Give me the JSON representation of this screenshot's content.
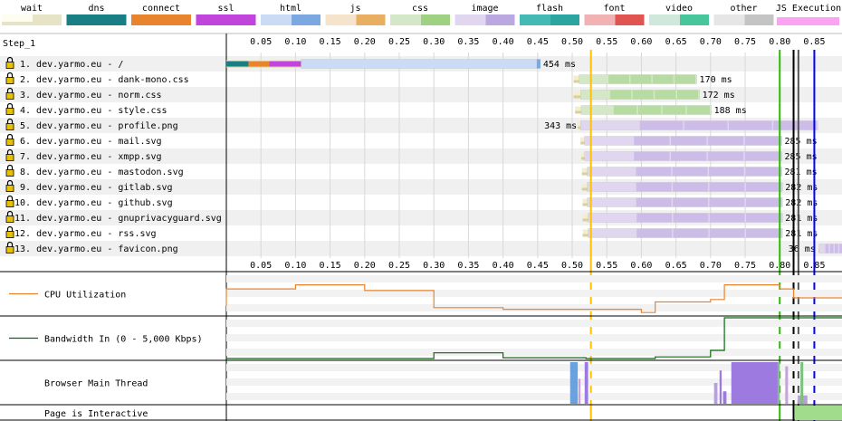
{
  "legend": [
    {
      "name": "wait",
      "color": "#fefdf2",
      "dark": "#e7e3c6"
    },
    {
      "name": "dns",
      "color": "#1a7f85",
      "dark": "#1a7f85"
    },
    {
      "name": "connect",
      "color": "#e7842d",
      "dark": "#e7842d"
    },
    {
      "name": "ssl",
      "color": "#c144dd",
      "dark": "#c144dd"
    },
    {
      "name": "html",
      "color": "#c9dcf4",
      "dark": "#7ba8e0"
    },
    {
      "name": "js",
      "color": "#f6e3cc",
      "dark": "#e8ae62"
    },
    {
      "name": "css",
      "color": "#d4e8c8",
      "dark": "#9ed182"
    },
    {
      "name": "image",
      "color": "#e0d6f0",
      "dark": "#bca8e0"
    },
    {
      "name": "flash",
      "color": "#45b9b4",
      "dark": "#2aa5a0"
    },
    {
      "name": "font",
      "color": "#f0b2b2",
      "dark": "#e0554f"
    },
    {
      "name": "video",
      "color": "#cfe8dc",
      "dark": "#47c59b"
    },
    {
      "name": "other",
      "color": "#e6e6e6",
      "dark": "#c4c4c4"
    },
    {
      "name": "JS Execution",
      "color": "#fba2f0",
      "dark": "#fba2f0"
    }
  ],
  "step_label": "Step_1",
  "chart_data": {
    "type": "waterfall",
    "x_unit": "seconds",
    "xlim": [
      0,
      0.89
    ],
    "ticks": [
      "0.05",
      "0.10",
      "0.15",
      "0.20",
      "0.25",
      "0.30",
      "0.35",
      "0.40",
      "0.45",
      "0.50",
      "0.55",
      "0.60",
      "0.65",
      "0.70",
      "0.75",
      "0.80",
      "0.85"
    ],
    "markers": [
      {
        "t": 0.527,
        "color": "#ffc000"
      },
      {
        "t": 0.8,
        "color": "#28bc00"
      },
      {
        "t": 0.82,
        "color": "#000000"
      },
      {
        "t": 0.827,
        "color": "#555555"
      },
      {
        "t": 0.85,
        "color": "#0000ff"
      }
    ],
    "requests": [
      {
        "label": "1. dev.yarmo.eu - /",
        "type": "html",
        "wait_start": 0.0,
        "dns": [
          0.0,
          0.032
        ],
        "connect": [
          0.032,
          0.062
        ],
        "ssl": [
          0.062,
          0.108
        ],
        "start": 0.108,
        "end": 0.454,
        "time": "454 ms",
        "time_left": false
      },
      {
        "label": "2. dev.yarmo.eu - dank-mono.css",
        "type": "css",
        "wait_start": 0.502,
        "start": 0.51,
        "end": 0.68,
        "time": "170 ms",
        "time_left": false
      },
      {
        "label": "3. dev.yarmo.eu - norm.css",
        "type": "css",
        "wait_start": 0.502,
        "start": 0.512,
        "end": 0.684,
        "time": "172 ms",
        "time_left": false
      },
      {
        "label": "4. dev.yarmo.eu - style.css",
        "type": "css",
        "wait_start": 0.504,
        "start": 0.513,
        "end": 0.701,
        "time": "188 ms",
        "time_left": false
      },
      {
        "label": "5. dev.yarmo.eu - profile.png",
        "type": "image",
        "wait_start": 0.508,
        "start": 0.512,
        "end": 0.855,
        "time": "343 ms",
        "time_left": true
      },
      {
        "label": "6. dev.yarmo.eu - mail.svg",
        "type": "image",
        "wait_start": 0.512,
        "start": 0.518,
        "end": 0.803,
        "time": "285 ms",
        "time_left": false
      },
      {
        "label": "7. dev.yarmo.eu - xmpp.svg",
        "type": "image",
        "wait_start": 0.513,
        "start": 0.518,
        "end": 0.803,
        "time": "285 ms",
        "time_left": false
      },
      {
        "label": "8. dev.yarmo.eu - mastodon.svg",
        "type": "image",
        "wait_start": 0.514,
        "start": 0.522,
        "end": 0.803,
        "time": "281 ms",
        "time_left": false
      },
      {
        "label": "9. dev.yarmo.eu - gitlab.svg",
        "type": "image",
        "wait_start": 0.514,
        "start": 0.522,
        "end": 0.804,
        "time": "282 ms",
        "time_left": false
      },
      {
        "label": "10. dev.yarmo.eu - github.svg",
        "type": "image",
        "wait_start": 0.515,
        "start": 0.522,
        "end": 0.804,
        "time": "282 ms",
        "time_left": false
      },
      {
        "label": "11. dev.yarmo.eu - gnuprivacyguard.svg",
        "type": "image",
        "wait_start": 0.515,
        "start": 0.523,
        "end": 0.804,
        "time": "281 ms",
        "time_left": false
      },
      {
        "label": "12. dev.yarmo.eu - rss.svg",
        "type": "image",
        "wait_start": 0.515,
        "start": 0.523,
        "end": 0.804,
        "time": "281 ms",
        "time_left": false
      },
      {
        "label": "13. dev.yarmo.eu - favicon.png",
        "type": "image",
        "wait_start": 0.856,
        "start": 0.857,
        "end": 0.893,
        "time": "36 ms",
        "time_left": true
      }
    ],
    "cpu_label": "CPU Utilization",
    "cpu_points": [
      [
        0,
        0.2
      ],
      [
        0.0,
        0.62
      ],
      [
        0.1,
        0.62
      ],
      [
        0.1,
        0.72
      ],
      [
        0.2,
        0.72
      ],
      [
        0.2,
        0.58
      ],
      [
        0.3,
        0.58
      ],
      [
        0.3,
        0.16
      ],
      [
        0.4,
        0.16
      ],
      [
        0.4,
        0.12
      ],
      [
        0.6,
        0.12
      ],
      [
        0.6,
        0.04
      ],
      [
        0.62,
        0.04
      ],
      [
        0.62,
        0.3
      ],
      [
        0.7,
        0.3
      ],
      [
        0.7,
        0.36
      ],
      [
        0.72,
        0.36
      ],
      [
        0.72,
        0.72
      ],
      [
        0.8,
        0.72
      ],
      [
        0.8,
        0.62
      ],
      [
        0.82,
        0.62
      ],
      [
        0.82,
        0.4
      ],
      [
        0.85,
        0.4
      ],
      [
        0.85,
        0.4
      ],
      [
        0.89,
        0.4
      ]
    ],
    "bandwidth_label": "Bandwidth In (0 - 5,000 Kbps)",
    "bw_points": [
      [
        0,
        0.0
      ],
      [
        0.3,
        0.0
      ],
      [
        0.3,
        0.14
      ],
      [
        0.4,
        0.14
      ],
      [
        0.4,
        0.02
      ],
      [
        0.52,
        0.02
      ],
      [
        0.52,
        0.0
      ],
      [
        0.62,
        0.0
      ],
      [
        0.62,
        0.04
      ],
      [
        0.7,
        0.04
      ],
      [
        0.7,
        0.2
      ],
      [
        0.72,
        0.2
      ],
      [
        0.72,
        1.0
      ],
      [
        0.89,
        1.0
      ]
    ],
    "main_thread_label": "Browser Main Thread",
    "interactive_label": "Page is Interactive"
  }
}
